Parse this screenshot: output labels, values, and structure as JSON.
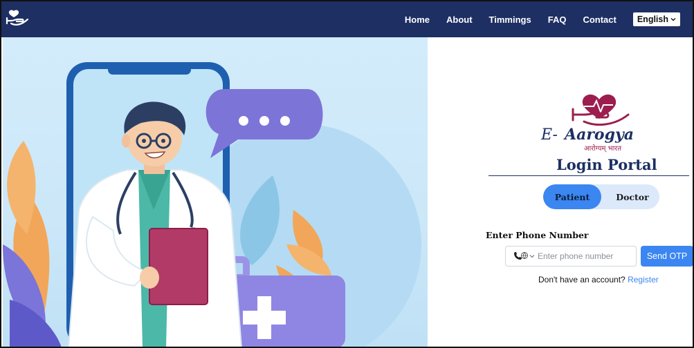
{
  "nav": {
    "links": [
      "Home",
      "About",
      "Timmings",
      "FAQ",
      "Contact"
    ],
    "language": "English"
  },
  "brand": {
    "name_prefix": "E-",
    "name_main": "Aarogya",
    "tagline_hindi": "आरोग्यम् भारत",
    "primary_color": "#1d2f63",
    "accent_color": "#8b1e4a"
  },
  "login": {
    "title": "Login Portal",
    "tabs": [
      {
        "label": "Patient",
        "active": true
      },
      {
        "label": "Doctor",
        "active": false
      }
    ],
    "phone_label": "Enter Phone Number",
    "phone_placeholder": "Enter phone number",
    "phone_value": "",
    "phone_prefix_icon": "phone-globe-icon",
    "send_button": "Send OTP",
    "register_prompt": "Don't have an account?",
    "register_link": "Register",
    "button_color": "#3b86f0"
  }
}
